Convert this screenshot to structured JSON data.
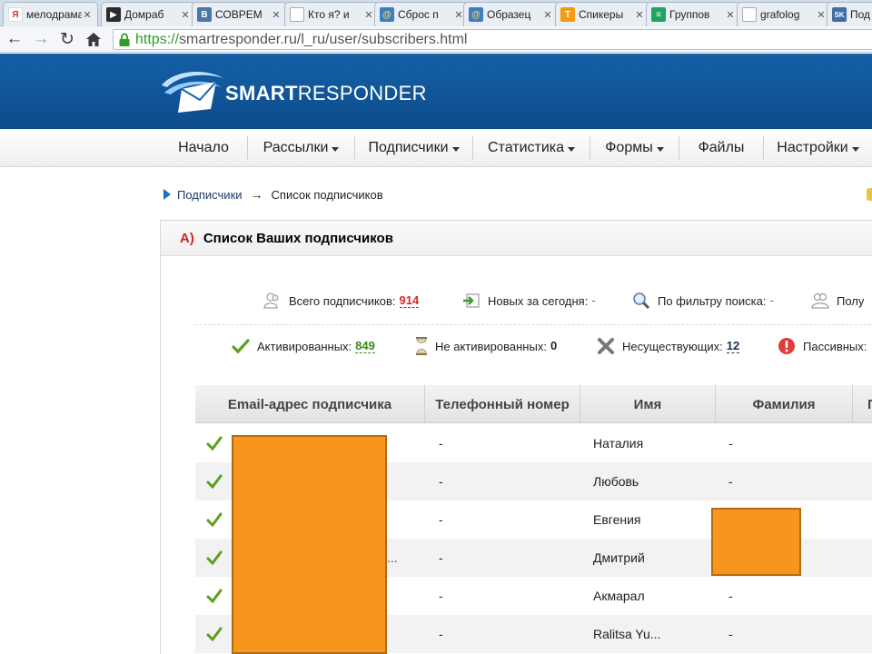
{
  "browser": {
    "tabs": [
      {
        "title": "мелодрама",
        "icon_text": "Я",
        "icon_color": "#ffffff",
        "icon_fg": "#e0301e"
      },
      {
        "title": "Домраб",
        "icon_text": "▶",
        "icon_color": "#2b2b2b",
        "icon_fg": "#ffffff"
      },
      {
        "title": "СОВРЕМ",
        "icon_text": "В",
        "icon_color": "#4a76a8",
        "icon_fg": "#ffffff"
      },
      {
        "title": "Кто я? и",
        "icon_text": "",
        "icon_color": "#ffffff",
        "icon_fg": "#999999"
      },
      {
        "title": "Сброс п",
        "icon_text": "@",
        "icon_color": "#3d7cc9",
        "icon_fg": "#ffd33a"
      },
      {
        "title": "Образец",
        "icon_text": "@",
        "icon_color": "#3d7cc9",
        "icon_fg": "#ffd33a"
      },
      {
        "title": "Спикеры",
        "icon_text": "T",
        "icon_color": "#f39c12",
        "icon_fg": "#ffffff"
      },
      {
        "title": "Группов",
        "icon_text": "≡",
        "icon_color": "#1ea362",
        "icon_fg": "#ffffff"
      },
      {
        "title": "grafolog",
        "icon_text": "",
        "icon_color": "#ffffff",
        "icon_fg": "#999999"
      },
      {
        "title": "Под",
        "icon_text": "SK",
        "icon_color": "#3f6ea5",
        "icon_fg": "#ffffff"
      }
    ],
    "tab_close_glyph": "✕",
    "url_scheme": "https://",
    "url_rest": "smartresponder.ru/l_ru/user/subscribers.html"
  },
  "header": {
    "brand_bold": "SMART",
    "brand_regular": "RESPONDER"
  },
  "menu": {
    "items": [
      {
        "label": "Начало",
        "dropdown": false
      },
      {
        "label": "Рассылки",
        "dropdown": true
      },
      {
        "label": "Подписчики",
        "dropdown": true
      },
      {
        "label": "Статистика",
        "dropdown": true
      },
      {
        "label": "Формы",
        "dropdown": true
      },
      {
        "label": "Файлы",
        "dropdown": false
      },
      {
        "label": "Настройки",
        "dropdown": true
      }
    ]
  },
  "breadcrumb": {
    "root": "Подписчики",
    "sep": "→",
    "current": "Список подписчиков"
  },
  "panel": {
    "letter": "A)",
    "title": "Список Ваших подписчиков"
  },
  "stats": {
    "total_label": "Всего подписчиков:",
    "total_value": "914",
    "new_label": "Новых за сегодня:",
    "new_value": "-",
    "filter_label": "По фильтру поиска:",
    "filter_value": "-",
    "received_label": "Полу",
    "activated_label": "Активированных:",
    "activated_value": "849",
    "not_activated_label": "Не активированных:",
    "not_activated_value": "0",
    "nonexistent_label": "Несуществующих:",
    "nonexistent_value": "12",
    "passive_label": "Пассивных:",
    "colors": {
      "total": "#d42c2c",
      "activated": "#3a8a1f",
      "nonexistent": "#1a2f55"
    }
  },
  "table": {
    "headers": [
      "Email-адрес подписчика",
      "Телефонный номер",
      "Имя",
      "Фамилия",
      "П"
    ],
    "rows": [
      {
        "phone": "-",
        "name": "Наталия",
        "surname": "-",
        "trunc": ""
      },
      {
        "phone": "-",
        "name": "Любовь",
        "surname": "-",
        "trunc": ""
      },
      {
        "phone": "-",
        "name": "Евгения",
        "surname": "",
        "trunc": ""
      },
      {
        "phone": "-",
        "name": "Дмитрий",
        "surname": "",
        "trunc": "..."
      },
      {
        "phone": "-",
        "name": "Акмарал",
        "surname": "-",
        "trunc": ""
      },
      {
        "phone": "-",
        "name": "Ralitsa Yu...",
        "surname": "-",
        "trunc": ""
      }
    ]
  },
  "colors": {
    "header_blue": "#1560a6",
    "redaction": "#f7951d",
    "check_green": "#5aa01e"
  }
}
